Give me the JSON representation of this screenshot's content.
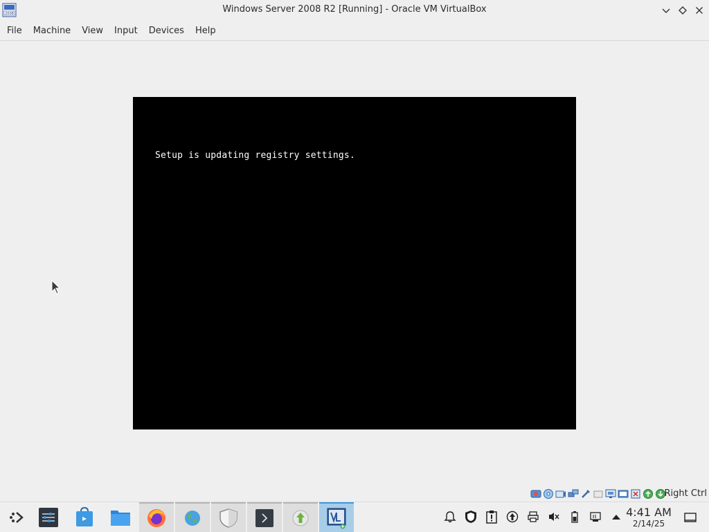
{
  "window": {
    "title": "Windows Server 2008 R2 [Running] - Oracle VM VirtualBox",
    "icon_badge": "2008"
  },
  "menu": {
    "items": [
      "File",
      "Machine",
      "View",
      "Input",
      "Devices",
      "Help"
    ]
  },
  "vm": {
    "screen_text": "Setup is updating registry settings."
  },
  "statusbar": {
    "icons": [
      "hard-disk-icon",
      "optical-drive-icon",
      "audio-icon",
      "network-icon",
      "usb-icon",
      "shared-folders-icon",
      "display-icon",
      "recording-icon",
      "cpu-icon",
      "mouse-integration-icon",
      "keyboard-icon"
    ],
    "host_key": "Right Ctrl"
  },
  "taskbar": {
    "apps": [
      "application-launcher-icon",
      "system-settings-icon",
      "discover-icon",
      "file-manager-icon",
      "firefox-icon",
      "globe-icon",
      "shield-icon",
      "terminal-icon",
      "update-icon",
      "virtualbox-icon"
    ],
    "tray": [
      "notifications-icon",
      "security-icon",
      "clipboard-icon",
      "updates-icon",
      "printer-icon",
      "volume-muted-icon",
      "battery-icon",
      "network-icon",
      "show-hidden-icon"
    ],
    "time": "4:41 AM",
    "date": "2/14/25"
  },
  "colors": {
    "background": "#efefef",
    "vm_screen": "#000000",
    "vm_text": "#ffffff",
    "active_task": "#a8cde9",
    "accent": "#3d9ae3"
  }
}
